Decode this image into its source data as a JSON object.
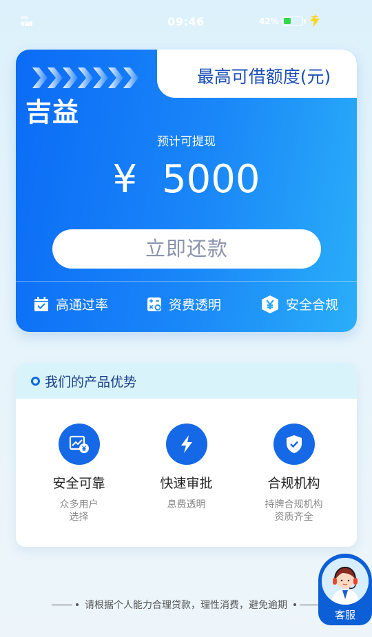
{
  "status_bar": {
    "network": "4G HD",
    "time": "09:46",
    "battery_percent": "42%",
    "battery_level": 0.42,
    "charging": true
  },
  "main_card": {
    "brand_name": "吉益",
    "limit_title": "最高可借额度(元)",
    "withdraw_label": "预计可提现",
    "currency_symbol": "¥",
    "amount": "5000",
    "repay_button_label": "立即还款",
    "features": [
      {
        "label": "高通过率",
        "icon": "calendar-check-icon"
      },
      {
        "label": "资费透明",
        "icon": "calculator-icon"
      },
      {
        "label": "安全合规",
        "icon": "yuan-shield-icon"
      }
    ],
    "colors": {
      "gradient_start": "#0b6bf6",
      "gradient_end": "#2aaef9",
      "tab_title": "#1d4fb6"
    }
  },
  "advantages": {
    "title": "我们的产品优势",
    "items": [
      {
        "title": "安全可靠",
        "desc_line1": "众多用户",
        "desc_line2": "选择",
        "icon": "money-chart-icon"
      },
      {
        "title": "快速审批",
        "desc_line1": "息费透明",
        "desc_line2": "",
        "icon": "lightning-icon"
      },
      {
        "title": "合规机构",
        "desc_line1": "持牌合规机构",
        "desc_line2": "资质齐全",
        "icon": "shield-check-icon"
      }
    ],
    "colors": {
      "icon_bg": "#1569e6",
      "header_bg": "#d9f3fb"
    }
  },
  "footer": {
    "note": "请根据个人能力合理贷款，理性消费，避免逾期"
  },
  "customer_service": {
    "label": "客服"
  }
}
